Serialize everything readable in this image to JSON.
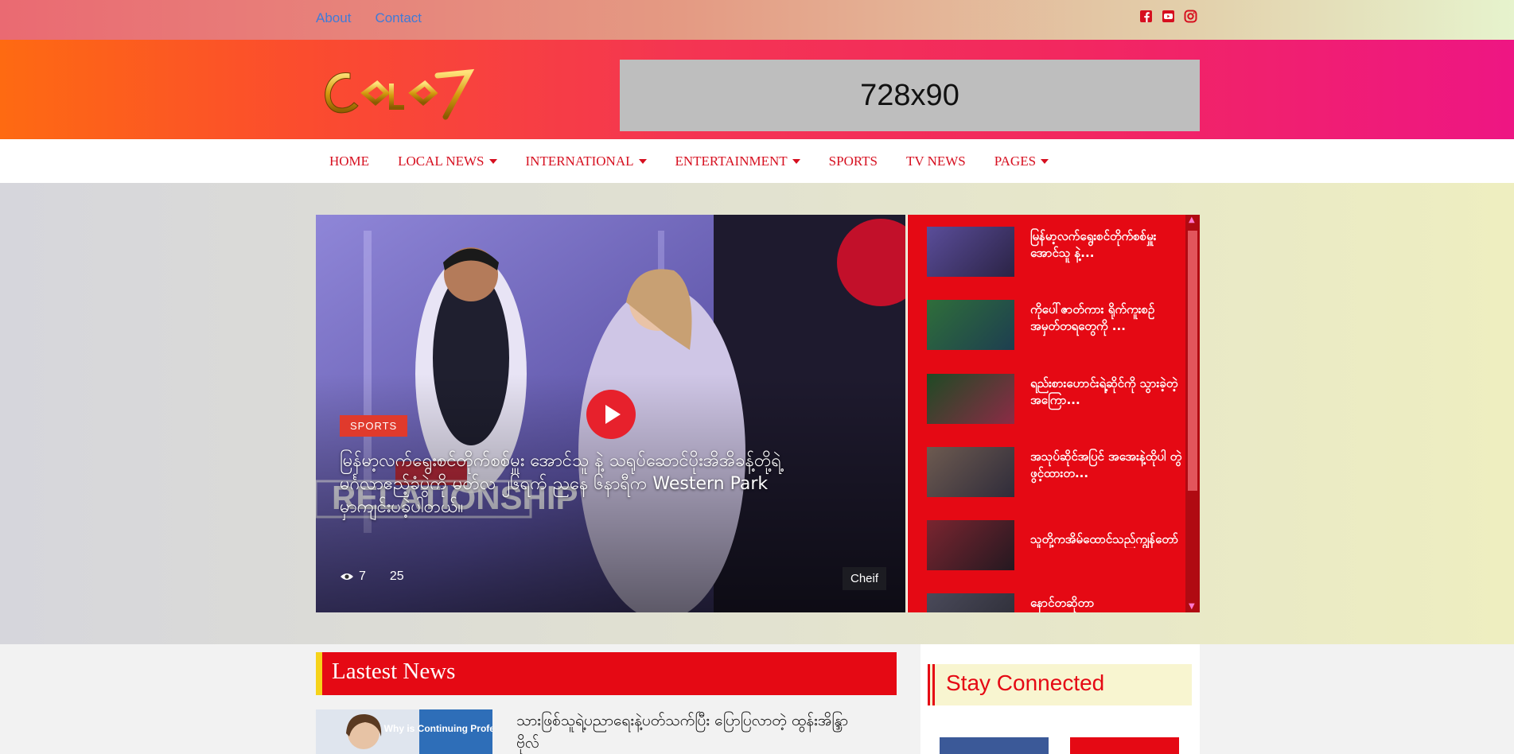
{
  "topbar": {
    "links": [
      "About",
      "Contact"
    ],
    "social": [
      "facebook-icon",
      "youtube-icon",
      "instagram-icon"
    ]
  },
  "header": {
    "logo_text": "CELE7",
    "ad_label": "728x90"
  },
  "nav": {
    "items": [
      {
        "label": "HOME",
        "dropdown": false
      },
      {
        "label": "LOCAL NEWS",
        "dropdown": true
      },
      {
        "label": "INTERNATIONAL",
        "dropdown": true
      },
      {
        "label": "ENTERTAINMENT",
        "dropdown": true
      },
      {
        "label": "SPORTS",
        "dropdown": false
      },
      {
        "label": "TV NEWS",
        "dropdown": false
      },
      {
        "label": "PAGES",
        "dropdown": true
      }
    ]
  },
  "hero": {
    "category": "SPORTS",
    "title": "မြန်မာ့လက်ရွေးစင်တိုက်စစ်မှူး အောင်သူ နဲ့ သရုပ်ဆောင်ပိုးအိအိခန့်တို့ရဲ့ မင်္ဂလာဧည့်ခံပွဲကို မတ်လ ၂၆ရက် ညနေ ၆နာရီက Western Park မှာကျင်းပခဲ့ပါတယ်။",
    "views": "7",
    "comments": "25",
    "author": "Cheif"
  },
  "sidelist": {
    "items": [
      {
        "title": "မြန်မာ့လက်ရွေးစင်တိုက်စစ်မှူး အောင်သူ နဲ့..."
      },
      {
        "title": "ကိုပေါ်ဇာတ်ကား ရိုက်ကူးစဉ်အမှတ်တရတွေကို ..."
      },
      {
        "title": "ရည်းစားဟောင်းရဲ့ဆိုင်ကို သွားခဲ့တဲ့အကြော..."
      },
      {
        "title": "အသုပ်ဆိုင်အပြင် အအေးနဲ့ထိုပါ တွဲဖွင့်ထားတ..."
      },
      {
        "title": "သူတို့ကအိမ်ထောင်သည်ကျွန်တော်"
      },
      {
        "title": "နောင်တဆိုတာ"
      }
    ]
  },
  "latest": {
    "heading": "Lastest News",
    "first_title": "သားဖြစ်သူရဲ့ပညာရေးနဲ့ပတ်သက်ပြီး ပြောပြလာတဲ့ ထွန်းအိန္ဒြာဗိုလ်",
    "first_image_text": "Why is Continuing Professional"
  },
  "sidebar": {
    "heading": "Stay Connected"
  },
  "colors": {
    "brand_red": "#e50914",
    "accent_yellow": "#f6d31a",
    "link_blue": "#3f7bd8"
  }
}
